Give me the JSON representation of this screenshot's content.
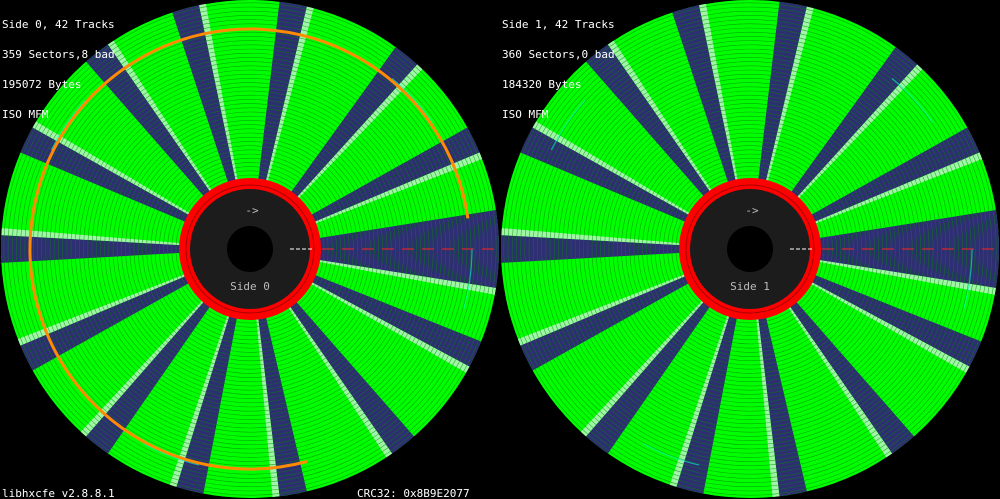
{
  "sides": [
    {
      "info": [
        "Side 0, 42 Tracks",
        "359 Sectors,8 bad",
        "195072 Bytes",
        "ISO MFM"
      ],
      "hub_label": "Side 0",
      "arrow": "->",
      "bad_sector_arc": true
    },
    {
      "info": [
        "Side 1, 42 Tracks",
        "360 Sectors,0 bad",
        "184320 Bytes",
        "ISO MFM"
      ],
      "hub_label": "Side 1",
      "arrow": "->",
      "bad_sector_arc": false
    }
  ],
  "footer": {
    "version": "libhxcfe v2.8.8.1",
    "crc": "CRC32: 0x8B9E2077"
  },
  "colors": {
    "good_sector": "#00ff00",
    "gap": "#2e2e73",
    "sector_header": "#9ff7a6",
    "hub_ring": "#ff0000",
    "hub": "#1c1c1c",
    "bad_sector_marker": "#ff8c00",
    "index_marker": "#00ffcc"
  }
}
